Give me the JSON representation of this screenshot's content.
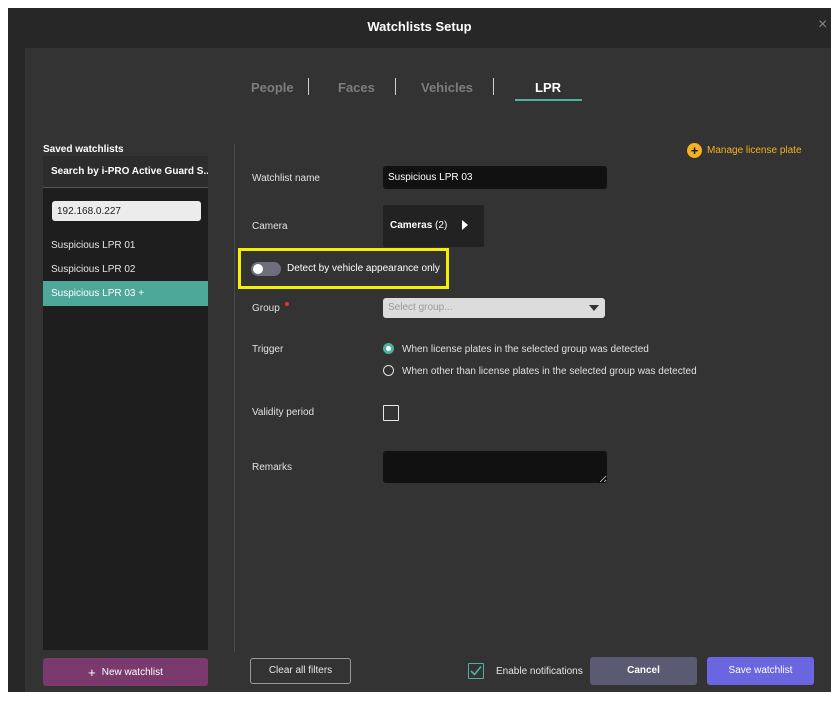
{
  "window": {
    "title": "Watchlists Setup",
    "close_glyph": "×"
  },
  "tabs": [
    {
      "label": "People",
      "active": false
    },
    {
      "label": "Faces",
      "active": false
    },
    {
      "label": "Vehicles",
      "active": false
    },
    {
      "label": "LPR",
      "active": true
    }
  ],
  "sidebar": {
    "title": "Saved watchlists",
    "header": "Search by i-PRO Active Guard S...",
    "ip_value": "192.168.0.227",
    "items": [
      {
        "label": "Suspicious LPR 01",
        "selected": false
      },
      {
        "label": "Suspicious LPR 02",
        "selected": false
      },
      {
        "label": "Suspicious LPR 03 +",
        "selected": true
      }
    ],
    "new_button": {
      "icon": "plus-icon",
      "label": "New watchlist"
    }
  },
  "form": {
    "manage_license_plate": "Manage license plate",
    "watchlist_name_label": "Watchlist name",
    "watchlist_name_value": "Suspicious LPR 03",
    "camera_label": "Camera",
    "cameras_button_label": "Cameras",
    "cameras_count": "(2)",
    "toggle_label": "Detect by vehicle appearance only",
    "toggle_on": false,
    "group_label": "Group",
    "group_placeholder": "Select group...",
    "trigger_label": "Trigger",
    "trigger_options": [
      {
        "label": "When license plates in the selected group was detected",
        "checked": true
      },
      {
        "label": "When other than license plates in the selected group was detected",
        "checked": false
      }
    ],
    "validity_label": "Validity period",
    "validity_checked": false,
    "remarks_label": "Remarks",
    "remarks_value": ""
  },
  "footer": {
    "clear_filters": "Clear all filters",
    "enable_notifications": "Enable notifications",
    "notifications_checked": true,
    "cancel": "Cancel",
    "save": "Save watchlist"
  },
  "colors": {
    "accent_teal": "#4fb0a0",
    "highlight_yellow": "#f3f000",
    "manage_orange": "#f3b21f",
    "new_watchlist_purple": "#7a3a6e",
    "save_blue": "#6a66e0",
    "cancel_gray": "#5a5a72"
  }
}
